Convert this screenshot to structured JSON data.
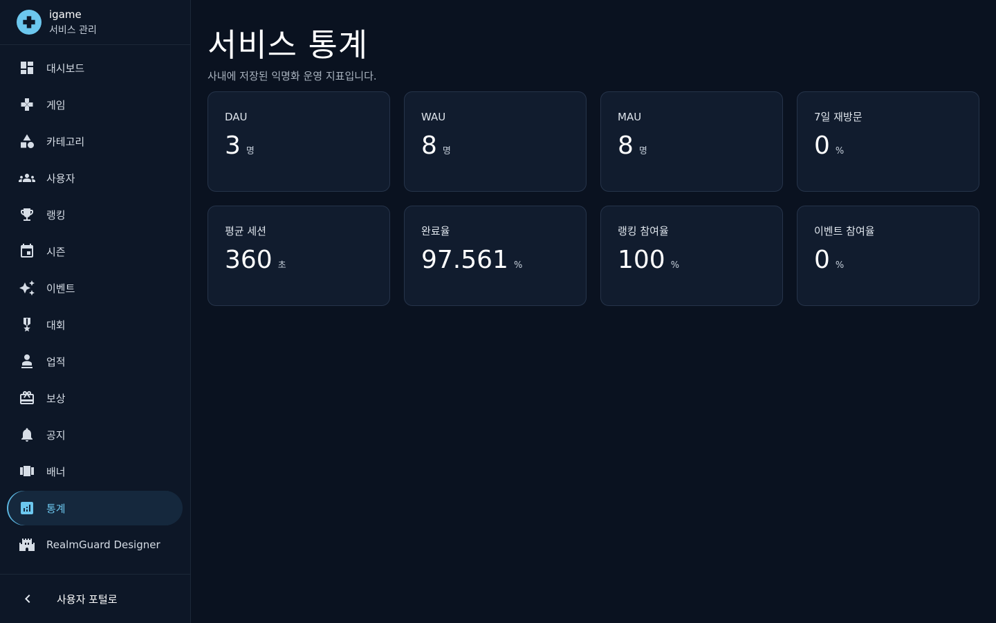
{
  "brand": {
    "name": "igame",
    "subtitle": "서비스 관리",
    "accent": "#6cc7ee"
  },
  "sidebar": {
    "items": [
      {
        "label": "대시보드",
        "icon": "dashboard-icon"
      },
      {
        "label": "게임",
        "icon": "gamepad-icon"
      },
      {
        "label": "카테고리",
        "icon": "category-icon"
      },
      {
        "label": "사용자",
        "icon": "users-icon"
      },
      {
        "label": "랭킹",
        "icon": "trophy-icon"
      },
      {
        "label": "시즌",
        "icon": "calendar-icon"
      },
      {
        "label": "이벤트",
        "icon": "sparkle-icon"
      },
      {
        "label": "대회",
        "icon": "medal-icon"
      },
      {
        "label": "업적",
        "icon": "achievement-icon"
      },
      {
        "label": "보상",
        "icon": "gift-icon"
      },
      {
        "label": "공지",
        "icon": "bell-icon"
      },
      {
        "label": "배너",
        "icon": "banner-icon"
      },
      {
        "label": "통계",
        "icon": "bar-chart-icon",
        "active": true
      },
      {
        "label": "RealmGuard Designer",
        "icon": "castle-icon"
      }
    ],
    "footer": {
      "label": "사용자 포털로",
      "icon": "chevron-left-icon"
    }
  },
  "main": {
    "title": "서비스 통계",
    "subtitle": "사내에 저장된 익명화 운영 지표입니다.",
    "stats": [
      {
        "label": "DAU",
        "value": "3",
        "unit": "명"
      },
      {
        "label": "WAU",
        "value": "8",
        "unit": "명"
      },
      {
        "label": "MAU",
        "value": "8",
        "unit": "명"
      },
      {
        "label": "7일 재방문",
        "value": "0",
        "unit": "%"
      },
      {
        "label": "평균 세션",
        "value": "360",
        "unit": "초"
      },
      {
        "label": "완료율",
        "value": "97.561",
        "unit": "%"
      },
      {
        "label": "랭킹 참여율",
        "value": "100",
        "unit": "%"
      },
      {
        "label": "이벤트 참여율",
        "value": "0",
        "unit": "%"
      }
    ]
  }
}
